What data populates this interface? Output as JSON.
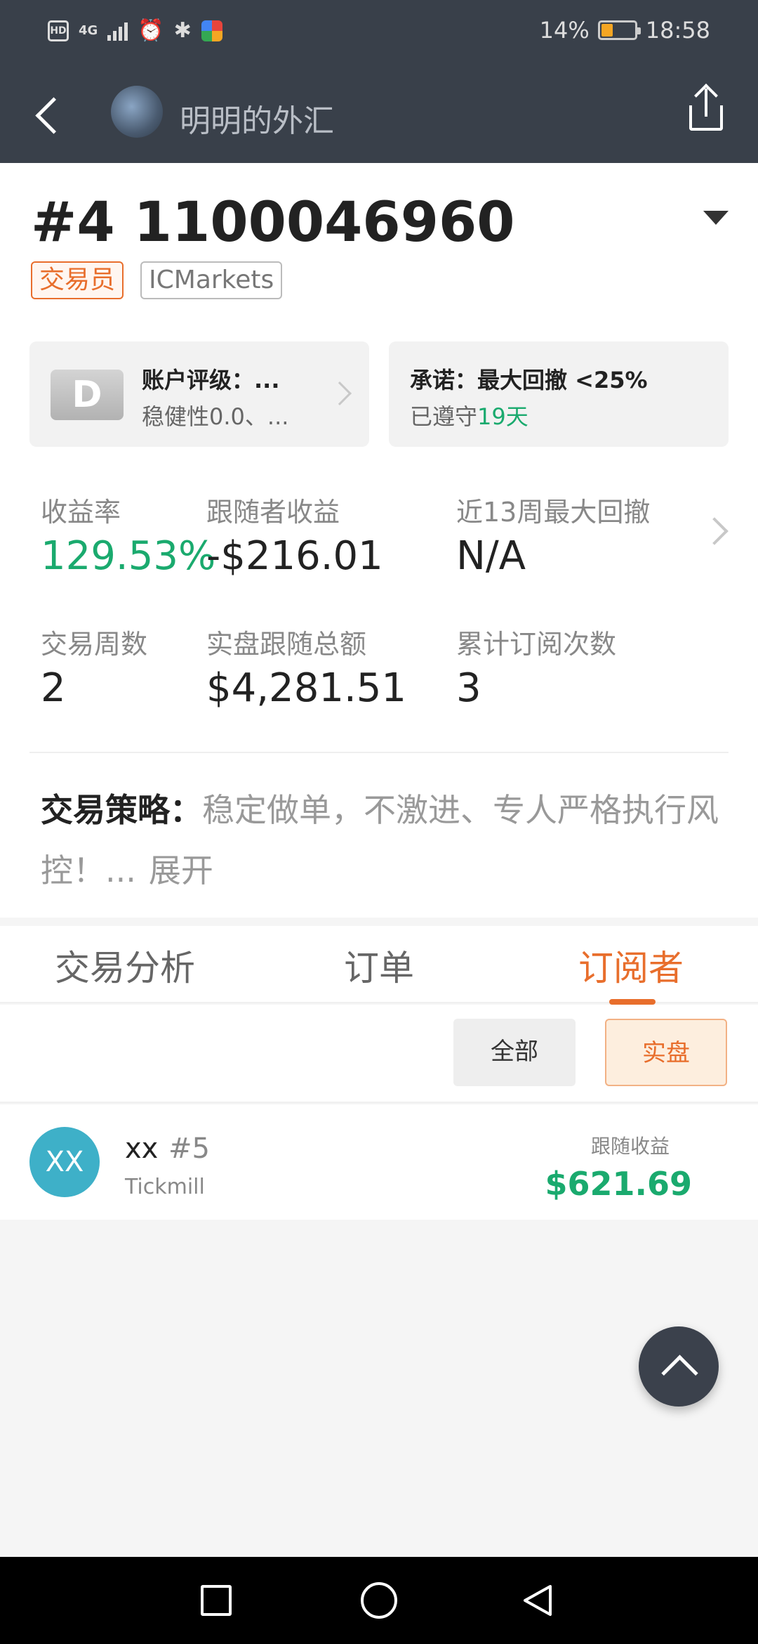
{
  "status_bar": {
    "hd": "HD",
    "network": "4G",
    "battery_percent": "14%",
    "battery_level": 0.14,
    "time": "18:58"
  },
  "header": {
    "title": "明明的外汇",
    "back_icon": "back-arrow-icon",
    "share_icon": "share-icon"
  },
  "account": {
    "id": "#4 1100046960",
    "tags": [
      "交易员",
      "ICMarkets"
    ]
  },
  "rating_card": {
    "grade": "D",
    "title": "账户评级：...",
    "subtitle": "稳健性0.0、..."
  },
  "commitment_card": {
    "title": "承诺：最大回撤 <25%",
    "subtitle_prefix": "已遵守",
    "days": "19天"
  },
  "stats": [
    {
      "label": "收益率",
      "value": "129.53%",
      "color": "#1aaa6e"
    },
    {
      "label": "跟随者收益",
      "value": "-$216.01"
    },
    {
      "label": "近13周最大回撤",
      "value": "N/A"
    },
    {
      "label": "交易周数",
      "value": "2"
    },
    {
      "label": "实盘跟随总额",
      "value": "$4,281.51"
    },
    {
      "label": "累计订阅次数",
      "value": "3"
    }
  ],
  "strategy": {
    "head": "交易策略：",
    "text": "稳定做单，不激进、专人严格执行风控！...",
    "expand": "展开"
  },
  "tabs": [
    "交易分析",
    "订单",
    "订阅者"
  ],
  "active_tab": "订阅者",
  "filters": [
    "全部",
    "实盘"
  ],
  "active_filter": "实盘",
  "subscribers": [
    {
      "avatar": "XX",
      "name": "xx",
      "rank": "#5",
      "broker": "Tickmill",
      "profit_label": "跟随收益",
      "profit": "$621.69"
    }
  ],
  "colors": {
    "accent": "#e86e2c",
    "profit": "#1aaa6e",
    "header_bg": "#39404a"
  }
}
